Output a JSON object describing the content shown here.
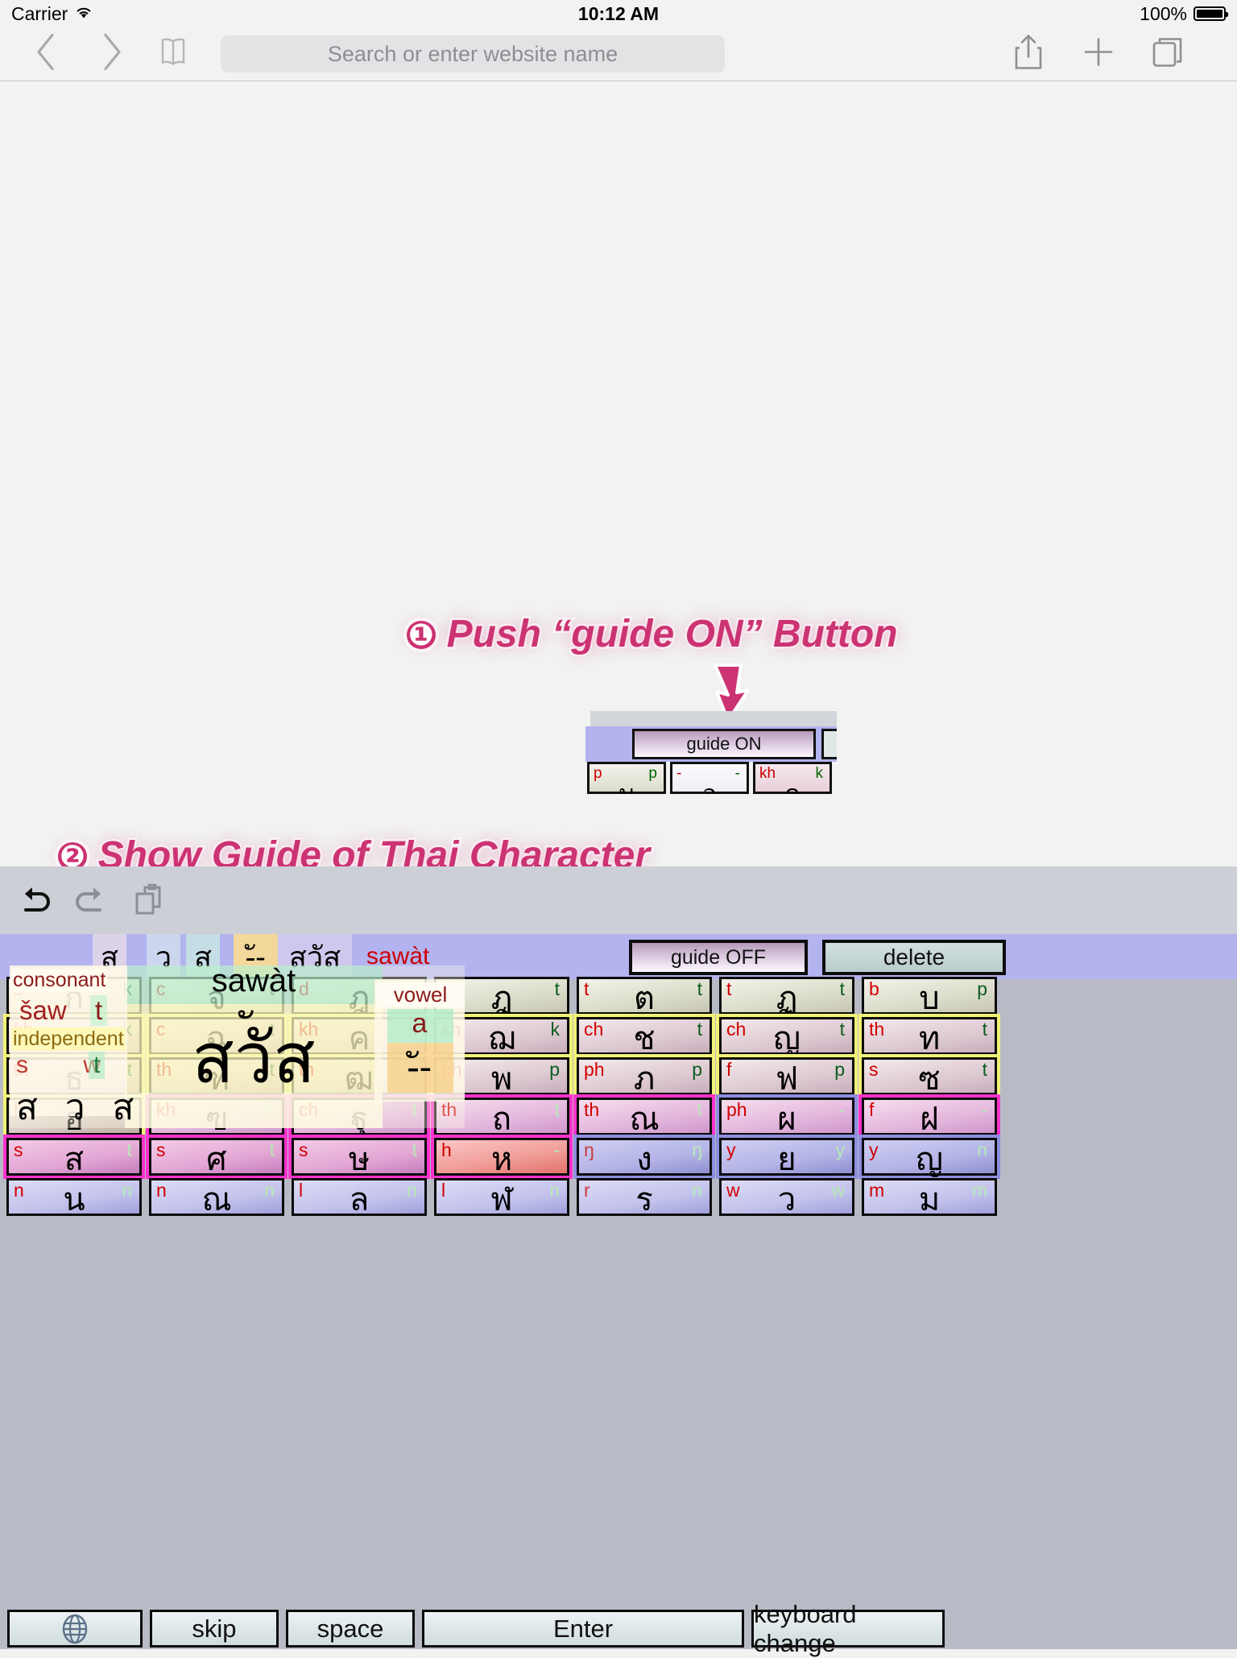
{
  "status_bar": {
    "carrier": "Carrier",
    "wifi_icon": "wifi-icon",
    "time": "10:12 AM",
    "battery_percent": "100%"
  },
  "browser": {
    "back_icon": "chevron-left-icon",
    "forward_icon": "chevron-right-icon",
    "bookmarks_icon": "book-icon",
    "share_icon": "share-icon",
    "newtab_icon": "plus-icon",
    "tabs_icon": "tabs-icon",
    "url_placeholder": "Search or enter website name",
    "url_value": ""
  },
  "callouts": [
    {
      "number": "❶",
      "text": "Push “guide ON” Button"
    },
    {
      "number": "❷",
      "text": "Show Guide of Thai Character"
    }
  ],
  "guide_on_inset": {
    "button_label": "guide ON",
    "keys": [
      {
        "left": "p",
        "center": "บ",
        "right": "p"
      },
      {
        "left": "-",
        "center": "อ",
        "right": "-"
      },
      {
        "left": "kh",
        "center": "ค",
        "right": "k"
      }
    ]
  },
  "keyboard": {
    "accessory": {
      "undo_icon": "undo-icon",
      "redo_icon": "redo-icon",
      "paste_icon": "paste-icon"
    },
    "candidates": [
      "ส",
      "ว",
      "ส",
      "-ั-",
      "สวัส"
    ],
    "candidate_romanization": "sawàt",
    "guide_off_label": "guide OFF",
    "delete_label": "delete",
    "rows": [
      [
        {
          "left": "s",
          "center": "ก",
          "right": "k"
        },
        {
          "left": "c",
          "center": "จ",
          "right": "t"
        },
        {
          "left": "d",
          "center": "ฎ",
          "right": "t"
        },
        {
          "left": "d",
          "center": "ฎ",
          "right": "t"
        },
        {
          "left": "t",
          "center": "ต",
          "right": "t"
        },
        {
          "left": "t",
          "center": "ฏ",
          "right": "t"
        },
        {
          "left": "b",
          "center": "บ",
          "right": "p"
        }
      ],
      [
        {
          "left": "kh",
          "center": "ข",
          "right": "k"
        },
        {
          "left": "c",
          "center": "ฉ",
          "right": "t"
        },
        {
          "left": "kh",
          "center": "ค",
          "right": "k"
        },
        {
          "left": "kh",
          "center": "ฌ",
          "right": "k"
        },
        {
          "left": "ch",
          "center": "ช",
          "right": "t"
        },
        {
          "left": "ch",
          "center": "ญ",
          "right": "t"
        },
        {
          "left": "th",
          "center": "ท",
          "right": "t"
        }
      ],
      [
        {
          "left": "th",
          "center": "ธ",
          "right": "t"
        },
        {
          "left": "th",
          "center": "ฑ",
          "right": "t"
        },
        {
          "left": "th",
          "center": "ฒ",
          "right": "t"
        },
        {
          "left": "ph",
          "center": "พ",
          "right": "p"
        },
        {
          "left": "ph",
          "center": "ภ",
          "right": "p"
        },
        {
          "left": "f",
          "center": "ฟ",
          "right": "p"
        },
        {
          "left": "s",
          "center": "ซ",
          "right": "t"
        }
      ],
      [
        {
          "left": "h",
          "center": "ฮ",
          "right": "-"
        },
        {
          "left": "kh",
          "center": "ฃ",
          "right": "k"
        },
        {
          "left": "ch",
          "center": "ฐ",
          "right": "t"
        },
        {
          "left": "th",
          "center": "ถ",
          "right": "t"
        },
        {
          "left": "th",
          "center": "ณ",
          "right": "t"
        },
        {
          "left": "ph",
          "center": "ผ",
          "right": "-"
        },
        {
          "left": "f",
          "center": "ฝ",
          "right": "-"
        }
      ],
      [
        {
          "left": "s",
          "center": "ส",
          "right": "t"
        },
        {
          "left": "s",
          "center": "ศ",
          "right": "t"
        },
        {
          "left": "s",
          "center": "ษ",
          "right": "t"
        },
        {
          "left": "h",
          "center": "ห",
          "right": "-"
        },
        {
          "left": "ŋ",
          "center": "ง",
          "right": "ŋ"
        },
        {
          "left": "y",
          "center": "ย",
          "right": "y"
        },
        {
          "left": "y",
          "center": "ญ",
          "right": "n"
        }
      ],
      [
        {
          "left": "n",
          "center": "น",
          "right": "n"
        },
        {
          "left": "n",
          "center": "ณ",
          "right": "n"
        },
        {
          "left": "l",
          "center": "ล",
          "right": "n"
        },
        {
          "left": "l",
          "center": "ฬ",
          "right": "n"
        },
        {
          "left": "r",
          "center": "ร",
          "right": "n"
        },
        {
          "left": "w",
          "center": "ว",
          "right": "w"
        },
        {
          "left": "m",
          "center": "ม",
          "right": "m"
        }
      ]
    ],
    "function_row": {
      "globe_icon": "globe-icon",
      "skip_label": "skip",
      "space_label": "space",
      "enter_label": "Enter",
      "keyboard_change_label": "keyboard change"
    }
  },
  "guide_overlay": {
    "consonant_label": "consonant",
    "consonant_roman": "šaw",
    "consonant_tone": "t",
    "independent_label": "independent",
    "independent_roman": "s w",
    "independent_tone": "t",
    "independent_thai": "ส ว ส",
    "word_roman": "sawàt",
    "word_mark": "ั",
    "word_thai": "สวัส",
    "vowel_label": "vowel",
    "vowel_roman": "a",
    "vowel_glyph": "-ั-"
  },
  "colors": {
    "accent_pink": "#cc3372",
    "keyboard_purple": "#b3b3f0",
    "red_label": "#d10000",
    "green_label": "#0a5c1e"
  }
}
